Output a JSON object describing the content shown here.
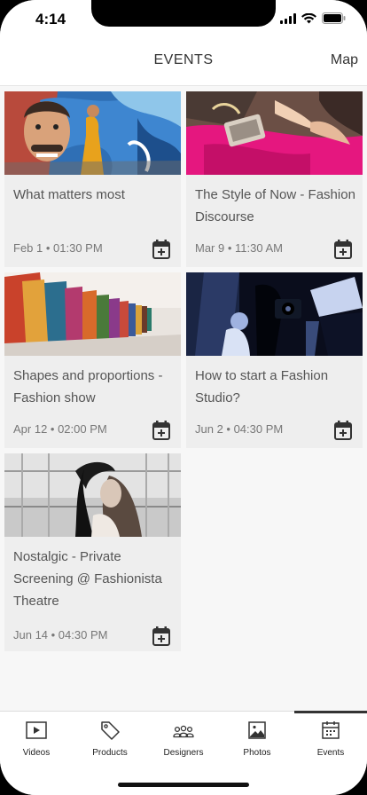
{
  "status": {
    "time": "4:14"
  },
  "header": {
    "title": "EVENTS",
    "map_label": "Map"
  },
  "events": [
    {
      "title": "What matters most",
      "date": "Feb 1 • 01:30 PM"
    },
    {
      "title": "The Style of Now - Fashion Discourse",
      "date": "Mar 9 • 11:30 AM"
    },
    {
      "title": "Shapes and proportions - Fashion show",
      "date": "Apr 12 • 02:00 PM"
    },
    {
      "title": "How to start a Fashion Studio?",
      "date": "Jun 2 • 04:30 PM"
    },
    {
      "title": "Nostalgic - Private Screening @ Fashionista Theatre",
      "date": "Jun 14 • 04:30 PM"
    }
  ],
  "tabs": [
    {
      "label": "Videos",
      "icon": "video-icon"
    },
    {
      "label": "Products",
      "icon": "tag-icon"
    },
    {
      "label": "Designers",
      "icon": "group-icon"
    },
    {
      "label": "Photos",
      "icon": "photo-icon"
    },
    {
      "label": "Events",
      "icon": "calendar-icon",
      "active": true
    }
  ],
  "colors": {
    "accent": "#333333",
    "card_bg": "#eeeeee",
    "page_bg": "#f7f7f7"
  }
}
